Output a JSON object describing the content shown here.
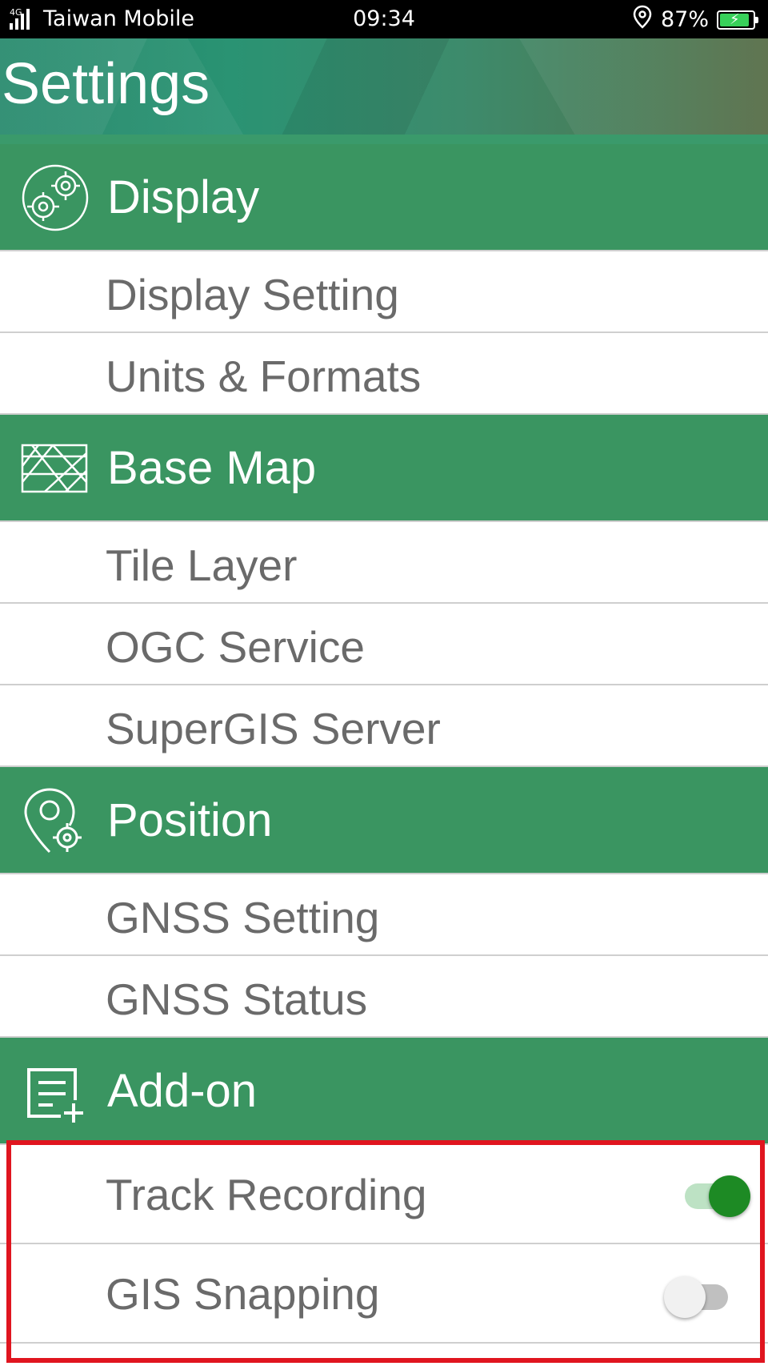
{
  "status_bar": {
    "network": "4G",
    "carrier": "Taiwan Mobile",
    "time": "09:34",
    "battery": "87%",
    "icons": [
      "signal-icon",
      "location-icon",
      "battery-charging-icon"
    ]
  },
  "header": {
    "title": "Settings"
  },
  "sections": [
    {
      "label": "Display",
      "icon": "gear-icon",
      "items": [
        "Display Setting",
        "Units & Formats"
      ]
    },
    {
      "label": "Base Map",
      "icon": "map-icon",
      "items": [
        "Tile Layer",
        "OGC Service",
        "SuperGIS Server"
      ]
    },
    {
      "label": "Position",
      "icon": "location-pin-icon",
      "items": [
        "GNSS Setting",
        "GNSS Status"
      ]
    },
    {
      "label": "Add-on",
      "icon": "add-list-icon",
      "items": [
        {
          "label": "Track Recording",
          "toggle": true
        },
        {
          "label": "GIS Snapping",
          "toggle": false
        }
      ]
    }
  ],
  "colors": {
    "section_green": "#3a9561",
    "toggle_on": "#1d8a24",
    "highlight": "#e0151f"
  }
}
